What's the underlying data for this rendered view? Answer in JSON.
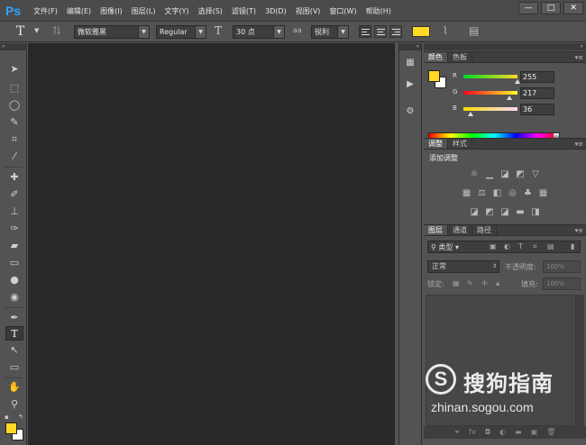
{
  "app": {
    "logo": "Ps"
  },
  "menu": [
    "文件(F)",
    "编辑(E)",
    "图像(I)",
    "图层(L)",
    "文字(Y)",
    "选择(S)",
    "滤镜(T)",
    "3D(D)",
    "视图(V)",
    "窗口(W)",
    "帮助(H)"
  ],
  "window_controls": {
    "minimize": "—",
    "maximize": "□",
    "close": "✕"
  },
  "options": {
    "tool_glyph": "T",
    "font_family": "微软雅黑",
    "font_style": "Regular",
    "font_size": "30 点",
    "aa_label": "aa",
    "aa_mode": "锐利",
    "text_color": "#ffd924"
  },
  "colors": {
    "foreground": "#ffd924",
    "background": "#ffffff",
    "canvas": "#282828"
  },
  "color_panel": {
    "tabs": [
      "颜色",
      "色板"
    ],
    "channels": [
      {
        "label": "R",
        "value": "255",
        "level": 1.0
      },
      {
        "label": "G",
        "value": "217",
        "level": 0.851
      },
      {
        "label": "B",
        "value": "36",
        "level": 0.141
      }
    ]
  },
  "adjust_panel": {
    "tabs": [
      "调整",
      "样式"
    ],
    "title": "添加调整"
  },
  "layers_panel": {
    "tabs": [
      "图层",
      "通道",
      "路径"
    ],
    "filter": "类型",
    "blend_mode": "正常",
    "opacity_label": "不透明度:",
    "opacity_value": "100%",
    "lock_label": "锁定:",
    "fill_label": "填充:",
    "fill_value": "100%"
  },
  "watermark": {
    "brand": "搜狗指南",
    "url": "zhinan.sogou.com"
  }
}
